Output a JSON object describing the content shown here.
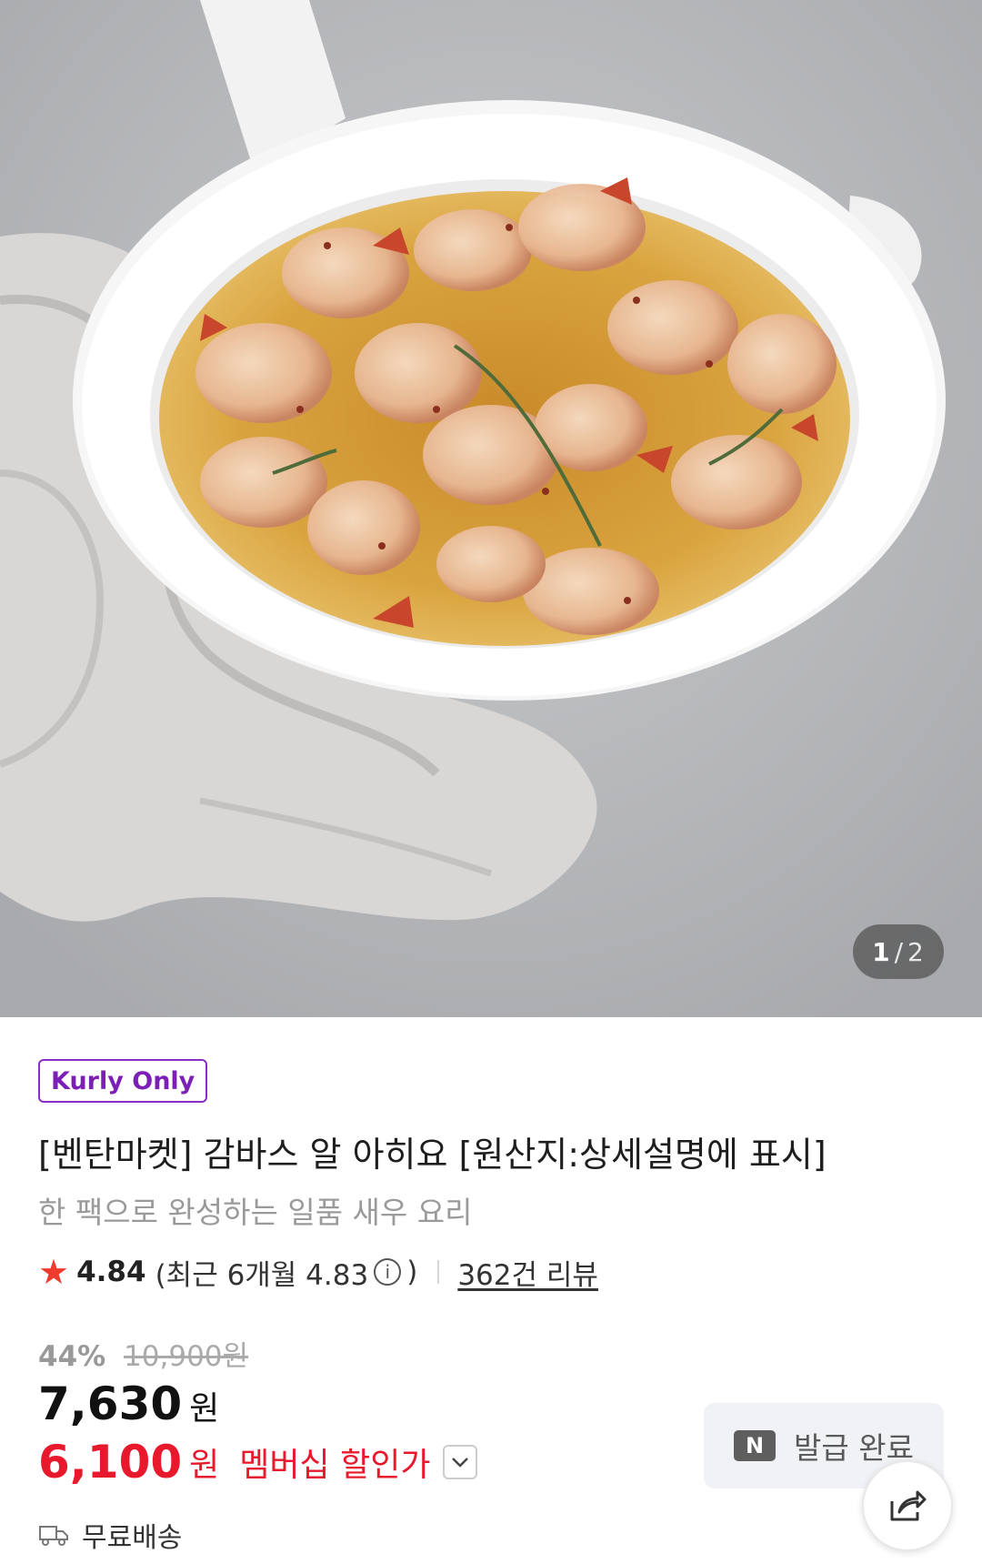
{
  "gallery": {
    "image_alt": "감바스 알 아히요 product photo",
    "current": "1",
    "separator": "/",
    "total": "2"
  },
  "product": {
    "badge": "Kurly Only",
    "title": "[벤탄마켓] 감바스 알 아히요 [원산지:상세설명에 표시]",
    "subtitle": "한 팩으로 완성하는 일품 새우 요리"
  },
  "rating": {
    "star_icon": "star-icon",
    "score": "4.84",
    "recent_prefix": "(최근 6개월 4.83",
    "info_glyph": "i",
    "recent_suffix": ")",
    "reviews_link": "362건 리뷰"
  },
  "price": {
    "discount_pct": "44%",
    "original_price": "10,900원",
    "sale_price": "7,630",
    "sale_unit": "원",
    "member_price": "6,100",
    "member_unit": "원",
    "member_label": "멤버십 할인가"
  },
  "coupon": {
    "icon_letter": "N",
    "label": "발급 완료"
  },
  "shipping": {
    "label": "무료배송"
  },
  "colors": {
    "accent_purple": "#7b1fb5",
    "member_red": "#e8192c",
    "star_red": "#ef3b2d"
  }
}
